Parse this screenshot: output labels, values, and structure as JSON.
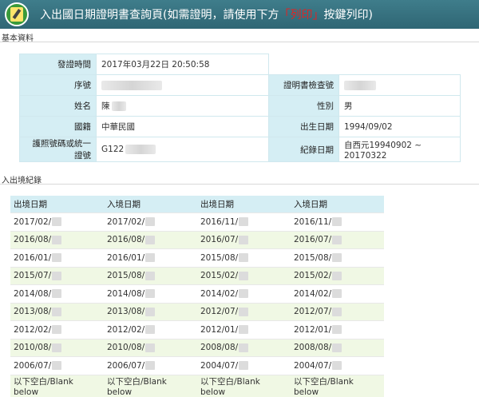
{
  "header": {
    "title_prefix": "入出國日期證明書查詢頁(如需證明，請使用下方",
    "title_red": "「列印」",
    "title_suffix": "按鍵列印)"
  },
  "basic": {
    "section_label": "基本資料",
    "issue_time_label": "發證時間",
    "issue_time_value": "2017年03月22日 20:50:58",
    "serial_label": "序號",
    "verify_label": "證明書檢查號",
    "name_label": "姓名",
    "name_value": "陳",
    "gender_label": "性別",
    "gender_value": "男",
    "nationality_label": "國籍",
    "nationality_value": "中華民國",
    "birth_label": "出生日期",
    "birth_value": "1994/09/02",
    "passport_label": "護照號碼或統一證號",
    "passport_value": "G122",
    "record_label": "紀錄日期",
    "record_value": "自西元19940902 ~ 20170322"
  },
  "records": {
    "section_label": "入出境紀錄",
    "headers": [
      "出境日期",
      "入境日期",
      "出境日期",
      "入境日期"
    ],
    "rows": [
      [
        "2017/02/",
        "2017/02/",
        "2016/11/",
        "2016/11/"
      ],
      [
        "2016/08/",
        "2016/08/",
        "2016/07/",
        "2016/07/"
      ],
      [
        "2016/01/",
        "2016/01/",
        "2015/08/",
        "2015/08/"
      ],
      [
        "2015/07/",
        "2015/08/",
        "2015/02/",
        "2015/02/"
      ],
      [
        "2014/08/",
        "2014/08/",
        "2014/02/",
        "2014/02/"
      ],
      [
        "2013/08/",
        "2013/08/",
        "2012/07/",
        "2012/07/"
      ],
      [
        "2012/02/",
        "2012/02/",
        "2012/01/",
        "2012/01/"
      ],
      [
        "2010/08/",
        "2010/08/",
        "2008/08/",
        "2008/08/"
      ],
      [
        "2006/07/",
        "2006/07/",
        "2004/07/",
        "2004/07/"
      ]
    ],
    "blank_label": "以下空白/Blank below"
  }
}
